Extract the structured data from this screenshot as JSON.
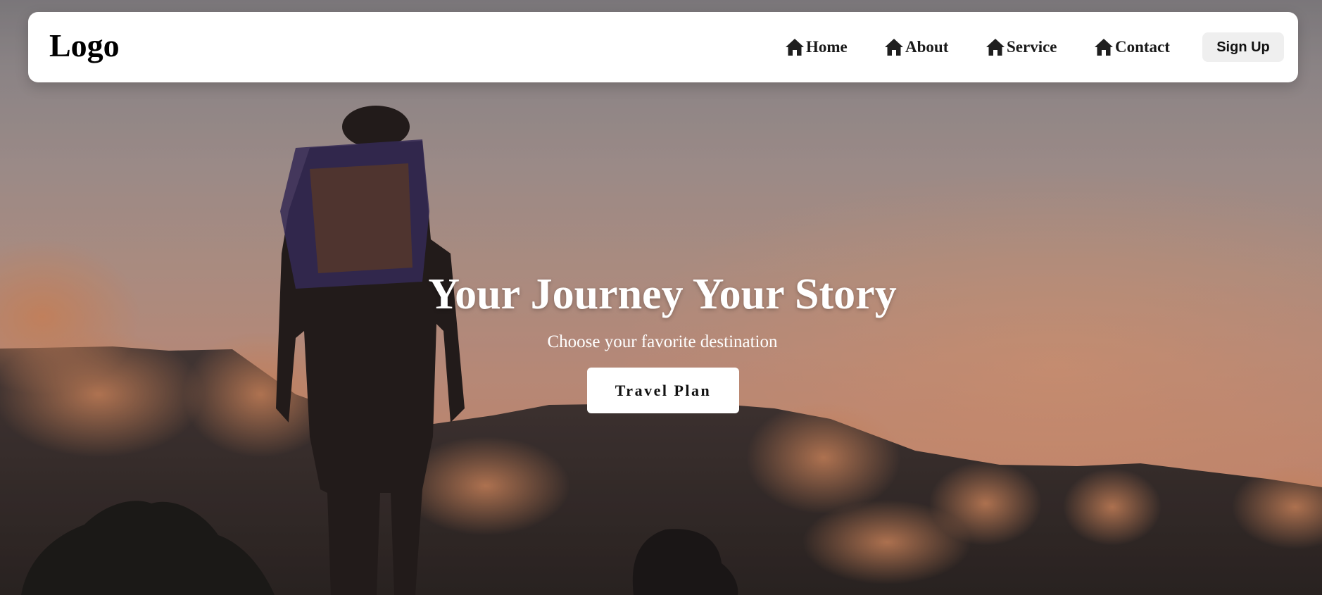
{
  "navbar": {
    "logo": "Logo",
    "links": [
      {
        "label": "Home",
        "icon": "home-icon"
      },
      {
        "label": "About",
        "icon": "home-icon"
      },
      {
        "label": "Service",
        "icon": "home-icon"
      },
      {
        "label": "Contact",
        "icon": "home-icon"
      }
    ],
    "signup_label": "Sign Up"
  },
  "hero": {
    "title": "Your Journey Your Story",
    "subtitle": "Choose your favorite destination",
    "cta_label": "Travel Plan",
    "background": "hiker-silhouette-sunset-mountains-photo"
  },
  "colors": {
    "navbar_bg": "#ffffff",
    "signup_bg": "#efefef",
    "hero_text": "#ffffff",
    "sky_warm": "#e39876"
  }
}
